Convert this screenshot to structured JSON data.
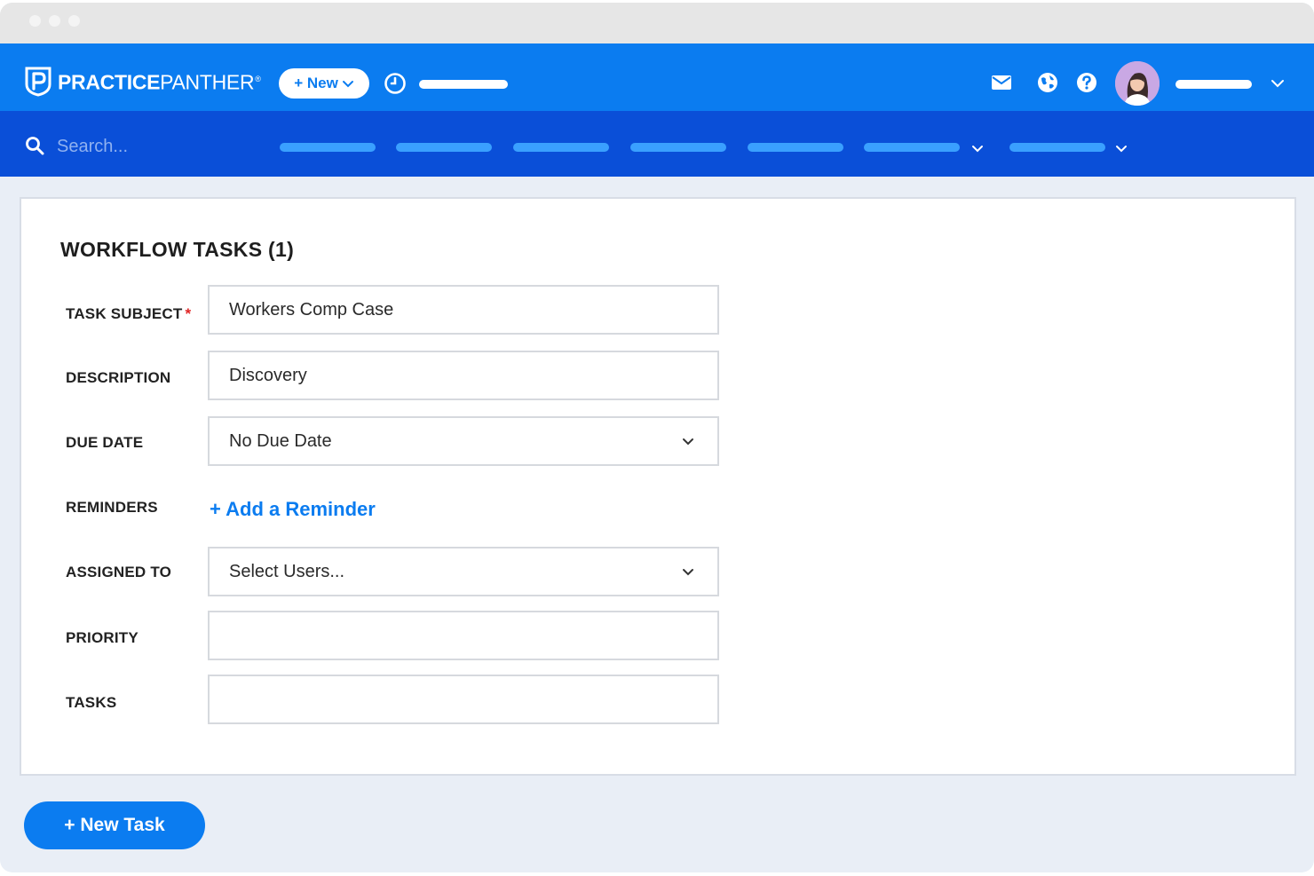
{
  "app": {
    "logo_bold": "PRACTICE",
    "logo_light": "PANTHER",
    "logo_reg": "®"
  },
  "topbar": {
    "new_button": "+ New",
    "icons": [
      "clock-icon",
      "mail-icon",
      "globe-icon",
      "help-icon",
      "avatar",
      "chevron-down-icon"
    ]
  },
  "navbar": {
    "search_placeholder": "Search..."
  },
  "form": {
    "title": "WORKFLOW TASKS (1)",
    "task_subject_label": "TASK SUBJECT",
    "task_subject_required": "*",
    "task_subject_value": "Workers Comp Case",
    "description_label": "DESCRIPTION",
    "description_value": "Discovery",
    "due_date_label": "DUE DATE",
    "due_date_value": "No Due Date",
    "reminders_label": "REMINDERS",
    "add_reminder": "+ Add a Reminder",
    "assigned_to_label": "ASSIGNED TO",
    "assigned_to_value": "Select Users...",
    "priority_label": "PRIORITY",
    "priority_value": "",
    "tasks_label": "TASKS",
    "tasks_value": ""
  },
  "footer": {
    "new_task_button": "+ New Task"
  },
  "colors": {
    "brand_blue": "#0b7cf0",
    "nav_blue": "#0a4fd8",
    "required_red": "#e02424"
  }
}
